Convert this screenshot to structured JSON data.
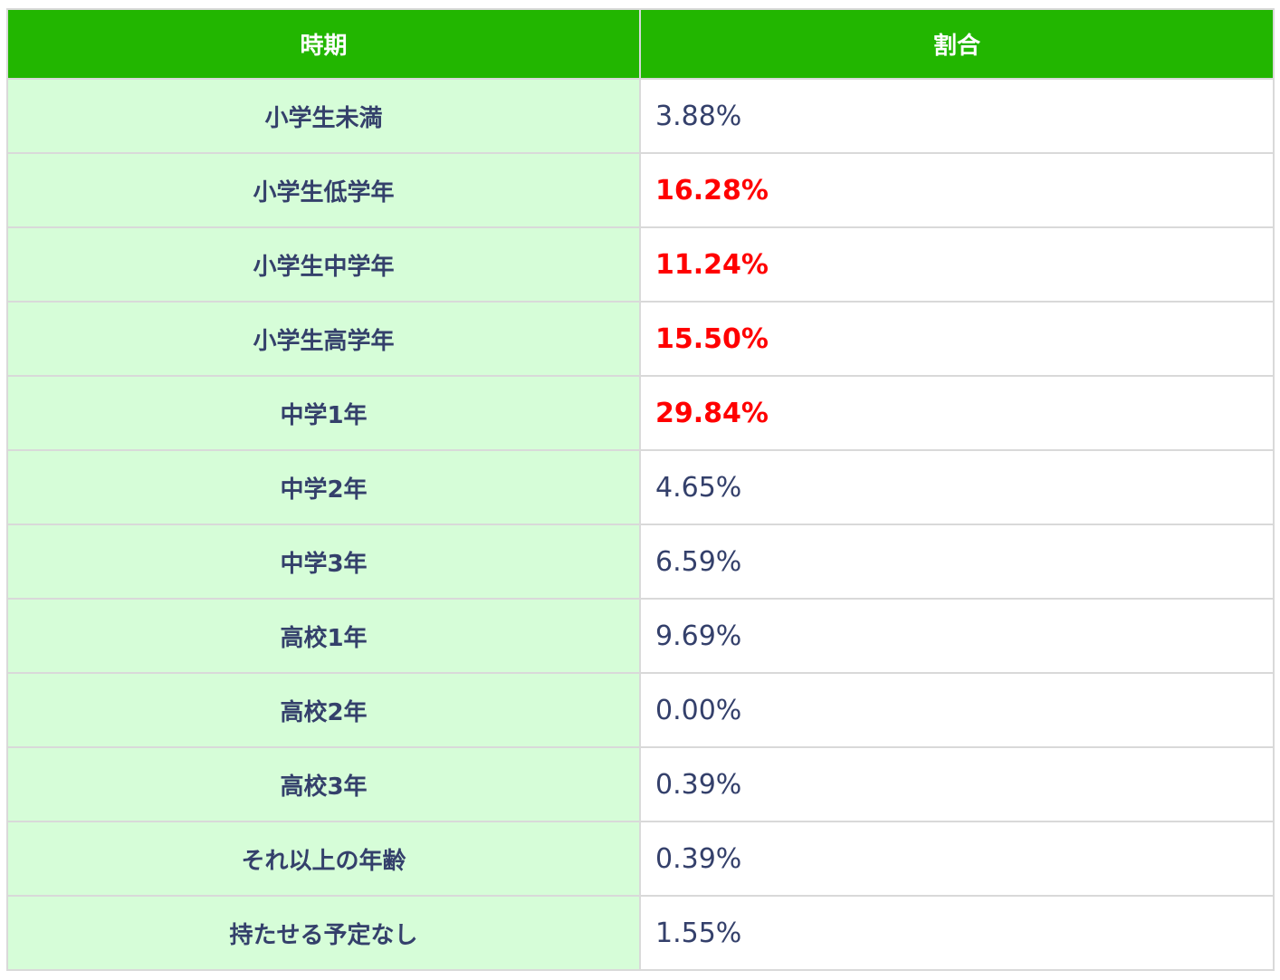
{
  "table": {
    "headers": [
      "時期",
      "割合"
    ],
    "highlight_color": "#ff0000",
    "header_bg": "#22b600",
    "label_bg": "#d6fdd8",
    "rows": [
      {
        "period": "小学生未満",
        "rate": "3.88%",
        "highlight": false
      },
      {
        "period": "小学生低学年",
        "rate": "16.28%",
        "highlight": true
      },
      {
        "period": "小学生中学年",
        "rate": "11.24%",
        "highlight": true
      },
      {
        "period": "小学生高学年",
        "rate": "15.50%",
        "highlight": true
      },
      {
        "period": "中学1年",
        "rate": "29.84%",
        "highlight": true
      },
      {
        "period": "中学2年",
        "rate": "4.65%",
        "highlight": false
      },
      {
        "period": "中学3年",
        "rate": "6.59%",
        "highlight": false
      },
      {
        "period": "高校1年",
        "rate": "9.69%",
        "highlight": false
      },
      {
        "period": "高校2年",
        "rate": "0.00%",
        "highlight": false
      },
      {
        "period": "高校3年",
        "rate": "0.39%",
        "highlight": false
      },
      {
        "period": "それ以上の年齢",
        "rate": "0.39%",
        "highlight": false
      },
      {
        "period": "持たせる予定なし",
        "rate": "1.55%",
        "highlight": false
      }
    ]
  }
}
